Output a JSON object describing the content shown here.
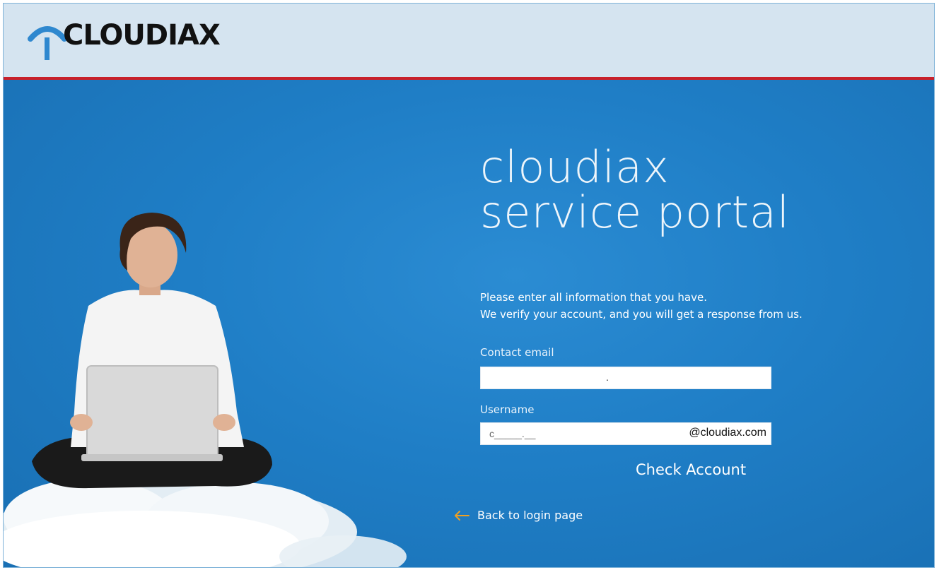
{
  "header": {
    "logo_text": "CLOUDIAX"
  },
  "title": {
    "line1": "cloudiax",
    "line2": "service portal"
  },
  "intro": {
    "line1": "Please enter all information that you have.",
    "line2": "We verify your account, and you will get a response from us."
  },
  "form": {
    "email_label": "Contact email",
    "email_value_dot": ".",
    "username_label": "Username",
    "username_value": "c_____.__",
    "username_suffix": "@cloudiax.com",
    "check_button": "Check Account"
  },
  "back_link": {
    "label": "Back to login page",
    "icon": "arrow-left-icon"
  },
  "colors": {
    "header_bg": "#d5e4f0",
    "header_rule": "#c8202a",
    "main_bg": "#1f7ec6",
    "logo_accent": "#2f88cf",
    "back_arrow": "#f0a020"
  }
}
